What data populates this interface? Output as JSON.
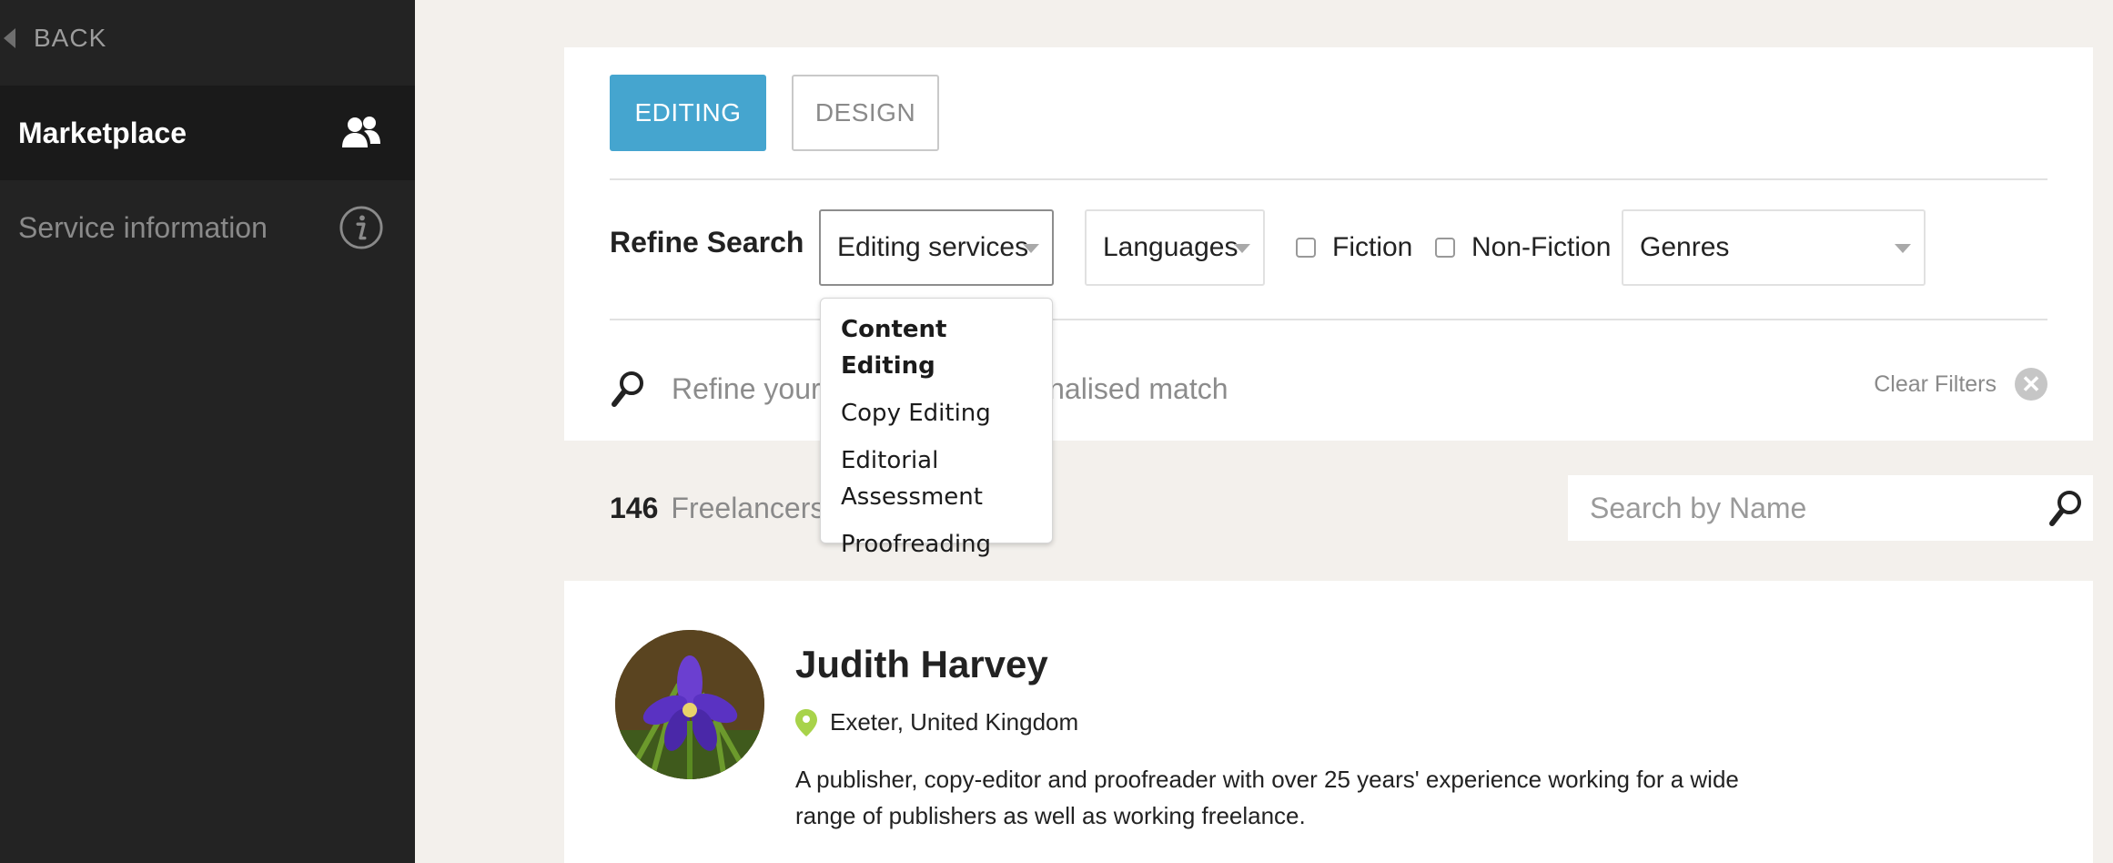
{
  "sidebar": {
    "back_label": "BACK",
    "items": [
      {
        "label": "Marketplace",
        "icon": "users-icon",
        "active": true
      },
      {
        "label": "Service information",
        "icon": "info-icon",
        "active": false
      }
    ]
  },
  "tabs": [
    {
      "label": "EDITING",
      "active": true
    },
    {
      "label": "DESIGN",
      "active": false
    }
  ],
  "filters": {
    "refine_label": "Refine Search",
    "services_select": "Editing services",
    "languages_select": "Languages",
    "fiction_label": "Fiction",
    "nonfiction_label": "Non-Fiction",
    "genres_select": "Genres",
    "search_placeholder_left": "Refine your",
    "search_placeholder_right": "rsonalised match",
    "clear_label": "Clear Filters"
  },
  "services_menu": {
    "items": [
      "Content Editing",
      "Copy Editing",
      "Editorial Assessment",
      "Proofreading"
    ]
  },
  "results": {
    "count": "146",
    "count_label": "Freelancers",
    "name_search_placeholder": "Search by Name"
  },
  "freelancer": {
    "name": "Judith Harvey",
    "location": "Exeter, United Kingdom",
    "description": "A publisher, copy-editor and proofreader with over 25 years' experience working for a wide range of publishers as well as working freelance."
  },
  "colors": {
    "accent": "#45a5cf",
    "sidebar_bg": "#232323",
    "page_bg": "#f3f0ec",
    "pin": "#a8d34a"
  }
}
